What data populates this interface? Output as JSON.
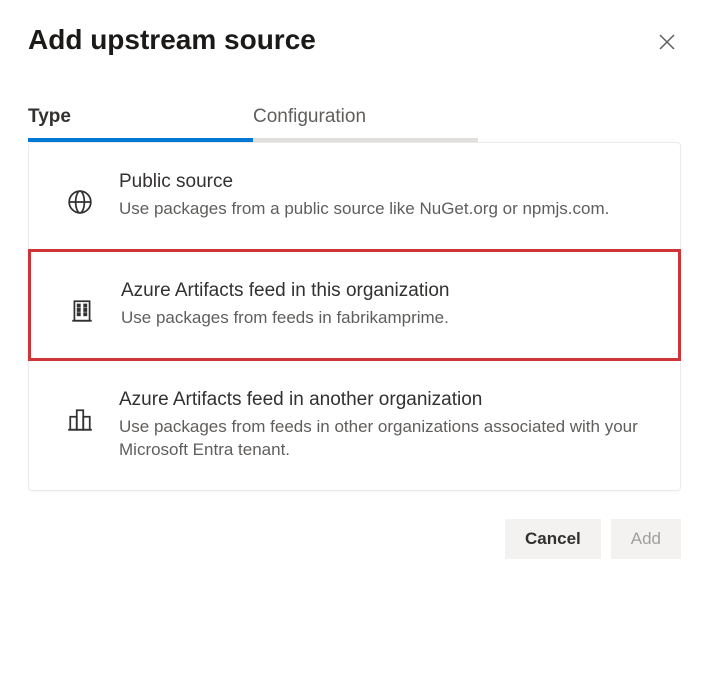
{
  "header": {
    "title": "Add upstream source"
  },
  "tabs": {
    "type": "Type",
    "configuration": "Configuration"
  },
  "options": {
    "public": {
      "title": "Public source",
      "desc": "Use packages from a public source like NuGet.org or npmjs.com."
    },
    "thisOrg": {
      "title": "Azure Artifacts feed in this organization",
      "desc": "Use packages from feeds in fabrikamprime."
    },
    "otherOrg": {
      "title": "Azure Artifacts feed in another organization",
      "desc": "Use packages from feeds in other organizations associated with your Microsoft Entra tenant."
    }
  },
  "footer": {
    "cancel": "Cancel",
    "add": "Add"
  }
}
